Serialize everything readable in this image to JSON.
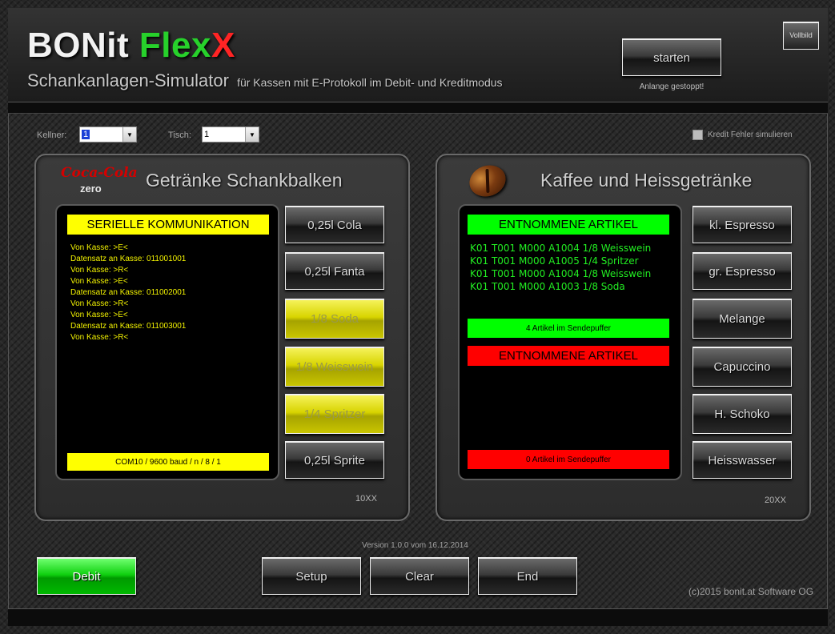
{
  "header": {
    "logo_part1": "BONit ",
    "logo_part2": "Flex",
    "logo_part3": "X",
    "subtitle": "Schankanlagen-Simulator",
    "subtitle_small": "für Kassen mit E-Protokoll im Debit- und Kreditmodus",
    "start_button": "starten",
    "status": "Anlange gestoppt!",
    "fullscreen_button": "Vollbild"
  },
  "controls": {
    "kellner_label": "Kellner:",
    "kellner_value": "1",
    "tisch_label": "Tisch:",
    "tisch_value": "1",
    "credit_error_label": "Kredit Fehler simulieren"
  },
  "left_panel": {
    "brand_top": "Coca-Cola",
    "brand_bottom": "zero",
    "title": "Getränke Schankbalken",
    "banner_top": "SERIELLE KOMMUNIKATION",
    "log": [
      "Von Kasse: >E<",
      "Datensatz an Kasse: 011001001",
      "Von Kasse: >R<",
      "Von Kasse: >E<",
      "Datensatz an Kasse: 011002001",
      "Von Kasse: >R<",
      "Von Kasse: >E<",
      "Datensatz an Kasse: 011003001",
      "Von Kasse: >R<"
    ],
    "banner_bottom": "COM10 / 9600 baud / n / 8 / 1",
    "buttons": [
      "0,25l Cola",
      "0,25l Fanta",
      "1/8 Soda",
      "1/8 Weisswein",
      "1/4 Spritzer",
      "0,25l Sprite"
    ],
    "code": "10XX"
  },
  "right_panel": {
    "title": "Kaffee und Heissgetränke",
    "banner_green": "ENTNOMMENE  ARTIKEL",
    "articles": [
      "K01 T001 M000 A1004 1/8 Weisswein",
      "K01 T001 M000 A1005 1/4 Spritzer",
      "K01 T001 M000 A1004 1/8 Weisswein",
      "K01 T001 M000 A1003 1/8 Soda"
    ],
    "buffer_green": "4 Artikel im Sendepuffer",
    "banner_red": "ENTNOMMENE  ARTIKEL",
    "buffer_red": "0 Artikel im Sendepuffer",
    "buttons": [
      "kl. Espresso",
      "gr. Espresso",
      "Melange",
      "Capuccino",
      "H. Schoko",
      "Heisswasser"
    ],
    "code": "20XX"
  },
  "footer": {
    "version": "Version 1.0.0 vom 16.12.2014",
    "debit_button": "Debit",
    "setup_button": "Setup",
    "clear_button": "Clear",
    "end_button": "End",
    "copyright": "(c)2015 bonit.at Software OG"
  },
  "colors": {
    "logo_green": "#27d12b",
    "logo_red": "#ff2424",
    "banner_yellow": "#ffff00",
    "banner_green": "#00ff00",
    "banner_red": "#ff0000",
    "log_text": "#f2f200",
    "article_text": "#22ee22"
  }
}
